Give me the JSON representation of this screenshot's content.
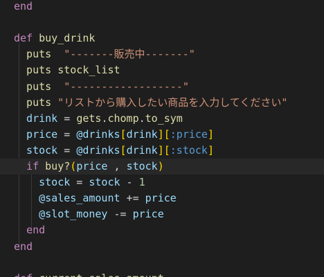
{
  "editor": {
    "lines": [
      {
        "tokens": [
          {
            "t": "end",
            "c": "kw"
          }
        ]
      },
      {
        "tokens": []
      },
      {
        "tokens": [
          {
            "t": "def ",
            "c": "kw"
          },
          {
            "t": "buy_drink",
            "c": "fn"
          }
        ]
      },
      {
        "tokens": [
          {
            "t": "  puts  ",
            "c": "fn"
          },
          {
            "t": "\"-------販売中-------\"",
            "c": "str"
          }
        ]
      },
      {
        "tokens": [
          {
            "t": "  puts ",
            "c": "fn"
          },
          {
            "t": "stock_list",
            "c": "fn"
          }
        ]
      },
      {
        "tokens": [
          {
            "t": "  puts  ",
            "c": "fn"
          },
          {
            "t": "\"------------------\"",
            "c": "str"
          }
        ]
      },
      {
        "tokens": [
          {
            "t": "  puts ",
            "c": "fn"
          },
          {
            "t": "\"リストから購入したい商品を入力してください\"",
            "c": "str"
          }
        ]
      },
      {
        "tokens": [
          {
            "t": "  drink",
            "c": "var"
          },
          {
            "t": " = ",
            "c": "op"
          },
          {
            "t": "gets",
            "c": "fn"
          },
          {
            "t": ".",
            "c": "op"
          },
          {
            "t": "chomp",
            "c": "fn"
          },
          {
            "t": ".",
            "c": "op"
          },
          {
            "t": "to_sym",
            "c": "fn"
          }
        ]
      },
      {
        "tokens": [
          {
            "t": "  price",
            "c": "var"
          },
          {
            "t": " = ",
            "c": "op"
          },
          {
            "t": "@drinks",
            "c": "ivar"
          },
          {
            "t": "[",
            "c": "bracket"
          },
          {
            "t": "drink",
            "c": "var"
          },
          {
            "t": "]",
            "c": "bracket"
          },
          {
            "t": "[",
            "c": "bracket"
          },
          {
            "t": ":price",
            "c": "sym"
          },
          {
            "t": "]",
            "c": "bracket"
          }
        ]
      },
      {
        "tokens": [
          {
            "t": "  stock",
            "c": "var"
          },
          {
            "t": " = ",
            "c": "op"
          },
          {
            "t": "@drinks",
            "c": "ivar"
          },
          {
            "t": "[",
            "c": "bracket"
          },
          {
            "t": "drink",
            "c": "var"
          },
          {
            "t": "]",
            "c": "bracket"
          },
          {
            "t": "[",
            "c": "bracket"
          },
          {
            "t": ":stock",
            "c": "sym"
          },
          {
            "t": "]",
            "c": "bracket"
          }
        ]
      },
      {
        "tokens": [
          {
            "t": "  if ",
            "c": "kw"
          },
          {
            "t": "buy?",
            "c": "fn"
          },
          {
            "t": "(",
            "c": "bracket"
          },
          {
            "t": "price",
            "c": "var"
          },
          {
            "t": " , ",
            "c": "op"
          },
          {
            "t": "stock",
            "c": "var"
          },
          {
            "t": ")",
            "c": "bracket"
          }
        ],
        "highlight": true
      },
      {
        "tokens": [
          {
            "t": "    stock",
            "c": "var"
          },
          {
            "t": " = ",
            "c": "op"
          },
          {
            "t": "stock",
            "c": "var"
          },
          {
            "t": " - ",
            "c": "op"
          },
          {
            "t": "1",
            "c": "num"
          }
        ]
      },
      {
        "tokens": [
          {
            "t": "    @sales_amount",
            "c": "ivar"
          },
          {
            "t": " += ",
            "c": "op"
          },
          {
            "t": "price",
            "c": "var"
          }
        ]
      },
      {
        "tokens": [
          {
            "t": "    @slot_money",
            "c": "ivar"
          },
          {
            "t": " -= ",
            "c": "op"
          },
          {
            "t": "price",
            "c": "var"
          }
        ]
      },
      {
        "tokens": [
          {
            "t": "  end",
            "c": "kw"
          }
        ]
      },
      {
        "tokens": [
          {
            "t": "end",
            "c": "kw"
          }
        ]
      },
      {
        "tokens": []
      },
      {
        "tokens": [
          {
            "t": "def ",
            "c": "kw"
          },
          {
            "t": "current_sales_amount",
            "c": "fn"
          }
        ]
      }
    ]
  },
  "colors": {
    "background": "#1e1e1e",
    "keyword": "#c586c0",
    "function": "#dcdcaa",
    "string": "#ce9178",
    "variable": "#9cdcfe",
    "bracket": "#ffd700"
  }
}
